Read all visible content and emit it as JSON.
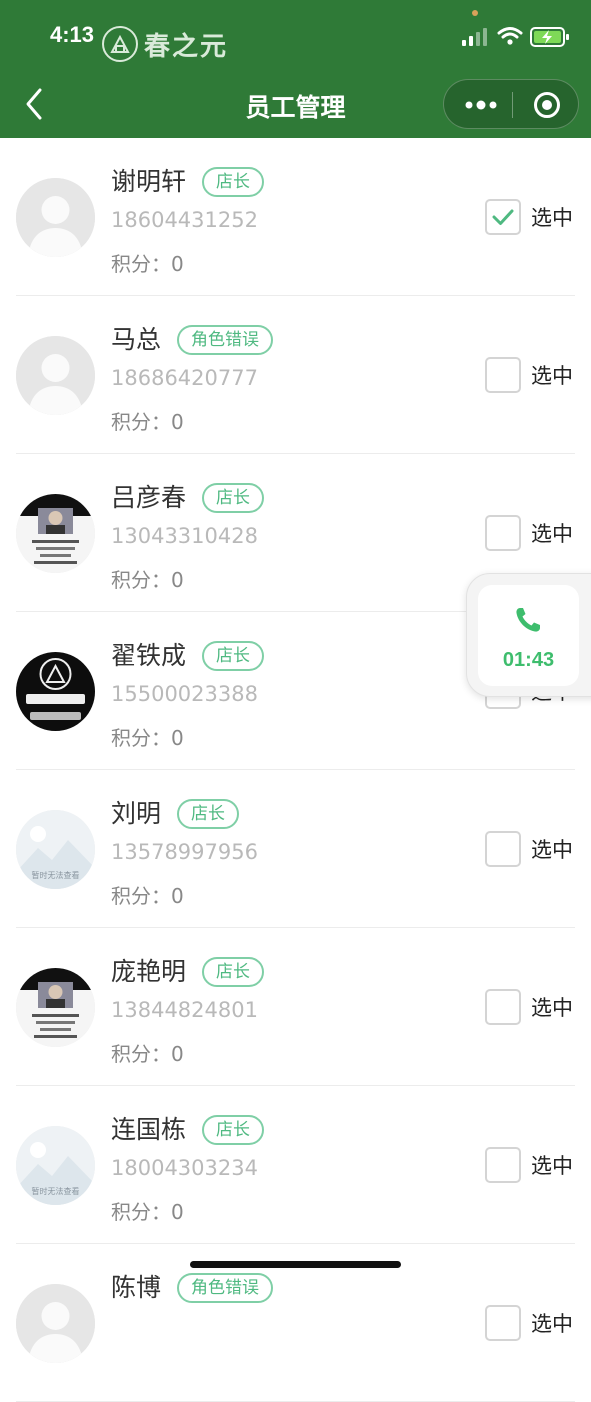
{
  "status_bar": {
    "time": "4:13",
    "brand": "春之元"
  },
  "nav": {
    "title": "员工管理"
  },
  "select_label": "选中",
  "points_label": "积分：",
  "employees": [
    {
      "name": "谢明轩",
      "role": "店长",
      "phone": "18604431252",
      "points": "0",
      "checked": true,
      "avatar": "default-avatar"
    },
    {
      "name": "马总",
      "role": "角色错误",
      "phone": "18686420777",
      "points": "0",
      "checked": false,
      "avatar": "default-avatar"
    },
    {
      "name": "吕彦春",
      "role": "店长",
      "phone": "13043310428",
      "points": "0",
      "checked": false,
      "avatar": "photo-avatar"
    },
    {
      "name": "翟铁成",
      "role": "店长",
      "phone": "15500023388",
      "points": "0",
      "checked": false,
      "avatar": "brand-logo-avatar"
    },
    {
      "name": "刘明",
      "role": "店长",
      "phone": "13578997956",
      "points": "0",
      "checked": false,
      "avatar": "unavailable-image",
      "avatar_text": "暂时无法查看"
    },
    {
      "name": "庞艳明",
      "role": "店长",
      "phone": "13844824801",
      "points": "0",
      "checked": false,
      "avatar": "photo-avatar"
    },
    {
      "name": "连国栋",
      "role": "店长",
      "phone": "18004303234",
      "points": "0",
      "checked": false,
      "avatar": "unavailable-image",
      "avatar_text": "暂时无法查看"
    },
    {
      "name": "陈博",
      "role": "角色错误",
      "phone": "",
      "points": "",
      "checked": false,
      "avatar": "default-avatar"
    }
  ],
  "floating_call": {
    "timer": "01:43"
  },
  "colors": {
    "header": "#2f7a37",
    "accent": "#4fb981",
    "call_green": "#3ebd6d"
  }
}
